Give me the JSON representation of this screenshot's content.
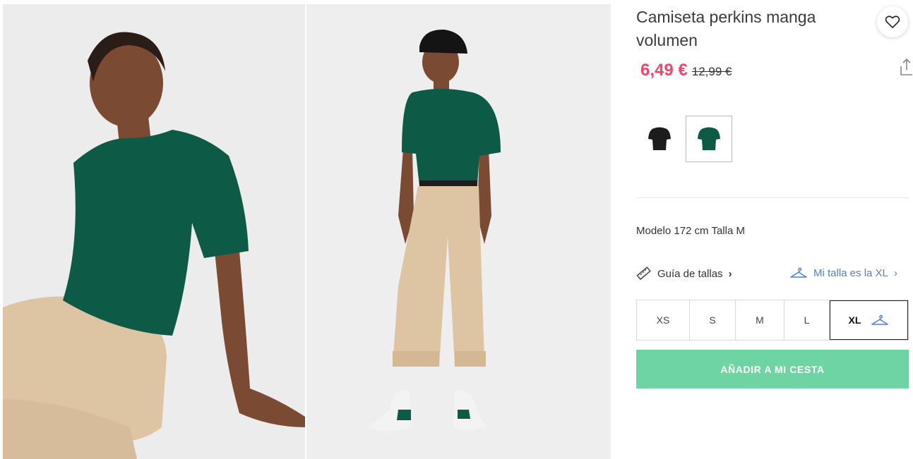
{
  "product": {
    "title": "Camiseta perkins manga volumen",
    "price_current": "6,49 €",
    "price_original": "12,99 €",
    "model_info": "Modelo 172 cm Talla M"
  },
  "gallery": {
    "images": [
      {
        "subject": "model sitting wearing green puff-sleeve top and beige trousers"
      },
      {
        "subject": "model standing wearing green top, beige trousers, black cap and sneakers"
      }
    ]
  },
  "colors": {
    "swatches": [
      {
        "name": "black",
        "hex": "#1c1c1c"
      },
      {
        "name": "green",
        "hex": "#0d5a46",
        "selected": true
      }
    ]
  },
  "size_links": {
    "guide_label": "Guía de tallas",
    "my_size_label": "Mi talla es la XL"
  },
  "sizes": [
    "XS",
    "S",
    "M",
    "L",
    "XL"
  ],
  "selected_size": "XL",
  "cart": {
    "add_label": "AÑADIR A MI CESTA"
  },
  "theme": {
    "price_color": "#f0466c",
    "button_color": "#6ed4a3",
    "link_color": "#4f7fd8",
    "product_color": "#0d5a46"
  }
}
